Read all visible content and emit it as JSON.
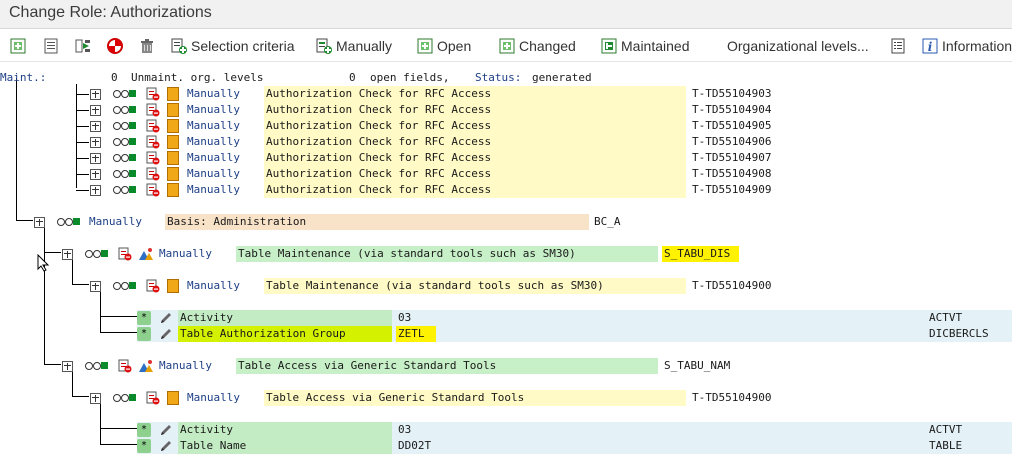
{
  "window": {
    "title": "Change Role: Authorizations"
  },
  "toolbar": {
    "selection_criteria": "Selection criteria",
    "manually": "Manually",
    "open": "Open",
    "changed": "Changed",
    "maintained": "Maintained",
    "org_levels": "Organizational levels...",
    "information": "Information"
  },
  "status_line": {
    "maint_label": "Maint.:",
    "unmaint_count": "0",
    "unmaint_text": "Unmaint. org. levels",
    "open_count": "0",
    "open_text": "open fields,",
    "status_label": "Status:",
    "status_value": "generated"
  },
  "rfc_rows": [
    {
      "type": "Manually",
      "text": "Authorization Check for RFC Access",
      "id": "T-TD55104903"
    },
    {
      "type": "Manually",
      "text": "Authorization Check for RFC Access",
      "id": "T-TD55104904"
    },
    {
      "type": "Manually",
      "text": "Authorization Check for RFC Access",
      "id": "T-TD55104905"
    },
    {
      "type": "Manually",
      "text": "Authorization Check for RFC Access",
      "id": "T-TD55104906"
    },
    {
      "type": "Manually",
      "text": "Authorization Check for RFC Access",
      "id": "T-TD55104907"
    },
    {
      "type": "Manually",
      "text": "Authorization Check for RFC Access",
      "id": "T-TD55104908"
    },
    {
      "type": "Manually",
      "text": "Authorization Check for RFC Access",
      "id": "T-TD55104909"
    }
  ],
  "basis": {
    "type": "Manually",
    "text": "Basis: Administration",
    "id": "BC_A"
  },
  "tabu_dis": {
    "object": {
      "type": "Manually",
      "text": "Table Maintenance (via standard tools such as SM30)",
      "id": "S_TABU_DIS"
    },
    "auth": {
      "type": "Manually",
      "text": "Table Maintenance (via standard tools such as SM30)",
      "id": "T-TD55104900"
    },
    "fields": [
      {
        "star": "*",
        "label": "Activity",
        "value": "03",
        "field": "ACTVT"
      },
      {
        "star": "*",
        "label": "Table Authorization Group",
        "value": "ZETL",
        "field": "DICBERCLS"
      }
    ]
  },
  "tabu_nam": {
    "object": {
      "type": "Manually",
      "text": "Table Access via Generic Standard Tools",
      "id": "S_TABU_NAM"
    },
    "auth": {
      "type": "Manually",
      "text": "Table Access via Generic Standard Tools",
      "id": "T-TD55104900"
    },
    "fields": [
      {
        "star": "*",
        "label": "Activity",
        "value": "03",
        "field": "ACTVT"
      },
      {
        "star": "*",
        "label": "Table Name",
        "value": "DD02T",
        "field": "TABLE"
      }
    ]
  }
}
